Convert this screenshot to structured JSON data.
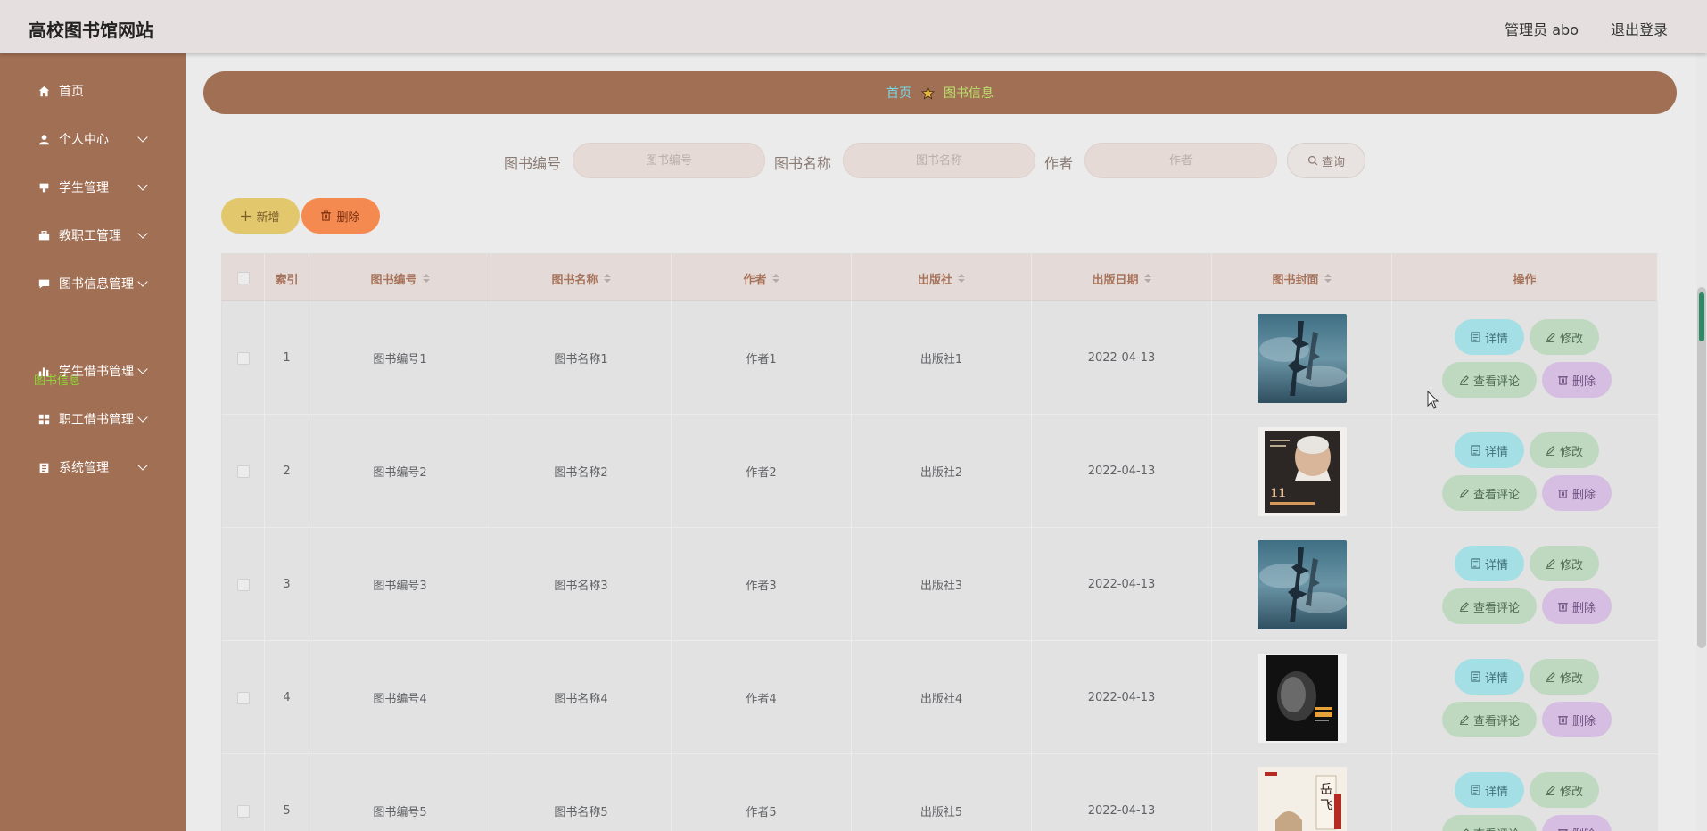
{
  "header": {
    "title": "高校图书馆网站",
    "admin": "管理员 abo",
    "logout": "退出登录"
  },
  "sidebar": {
    "items": [
      {
        "label": "首页",
        "icon": "home-icon",
        "has_children": false
      },
      {
        "label": "个人中心",
        "icon": "user-icon",
        "has_children": true
      },
      {
        "label": "学生管理",
        "icon": "student-icon",
        "has_children": true
      },
      {
        "label": "教职工管理",
        "icon": "briefcase-icon",
        "has_children": true
      },
      {
        "label": "图书信息管理",
        "icon": "chat-icon",
        "has_children": true
      },
      {
        "label": "学生借书管理",
        "icon": "bar-chart-icon",
        "has_children": true
      },
      {
        "label": "职工借书管理",
        "icon": "grid-icon",
        "has_children": true
      },
      {
        "label": "系统管理",
        "icon": "clipboard-icon",
        "has_children": true
      }
    ],
    "active_submenu": "图书信息"
  },
  "breadcrumb": {
    "home": "首页",
    "current": "图书信息"
  },
  "search": {
    "fields": [
      {
        "label": "图书编号",
        "placeholder": "图书编号"
      },
      {
        "label": "图书名称",
        "placeholder": "图书名称"
      },
      {
        "label": "作者",
        "placeholder": "作者"
      }
    ],
    "button": "查询"
  },
  "actions": {
    "add": "新增",
    "delete": "删除"
  },
  "table": {
    "columns": [
      "索引",
      "图书编号",
      "图书名称",
      "作者",
      "出版社",
      "出版日期",
      "图书封面",
      "操作"
    ],
    "row_buttons": {
      "detail": "详情",
      "edit": "修改",
      "comments": "查看评论",
      "remove": "删除"
    },
    "rows": [
      {
        "index": "1",
        "book_no": "图书编号1",
        "book_name": "图书名称1",
        "author": "作者1",
        "publisher": "出版社1",
        "date": "2022-04-13",
        "cover": "book-cover-langya"
      },
      {
        "index": "2",
        "book_no": "图书编号2",
        "book_name": "图书名称2",
        "author": "作者2",
        "publisher": "出版社2",
        "date": "2022-04-13",
        "cover": "book-cover-eleven-rings"
      },
      {
        "index": "3",
        "book_no": "图书编号3",
        "book_name": "图书名称3",
        "author": "作者3",
        "publisher": "出版社3",
        "date": "2022-04-13",
        "cover": "book-cover-langya"
      },
      {
        "index": "4",
        "book_no": "图书编号4",
        "book_name": "图书名称4",
        "author": "作者4",
        "publisher": "出版社4",
        "date": "2022-04-13",
        "cover": "book-cover-portrait"
      },
      {
        "index": "5",
        "book_no": "图书编号5",
        "book_name": "图书名称5",
        "author": "作者5",
        "publisher": "出版社5",
        "date": "2022-04-13",
        "cover": "book-cover-yuefei"
      }
    ]
  },
  "colors": {
    "sidebar": "#a16f53",
    "header": "#e5e0df",
    "active_submenu": "#8fd43a",
    "add_button": "#e2c76d",
    "delete_button": "#f48a50"
  }
}
